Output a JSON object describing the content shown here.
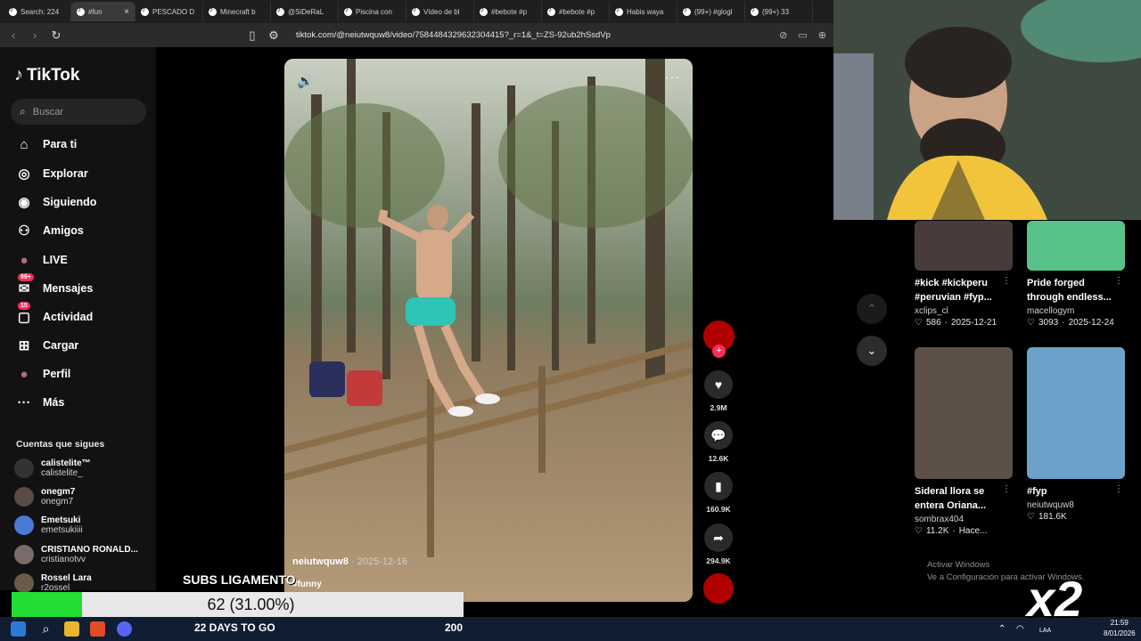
{
  "browser": {
    "tabs": [
      {
        "label": "Search: 224"
      },
      {
        "label": "#fun",
        "active": true
      },
      {
        "label": "PESCADO D"
      },
      {
        "label": "Minecraft b"
      },
      {
        "label": "@SiDeRaL"
      },
      {
        "label": "Piscina con"
      },
      {
        "label": "Vídeo de bl"
      },
      {
        "label": "#bebote #p"
      },
      {
        "label": "#bebote #p"
      },
      {
        "label": "Habis waya"
      },
      {
        "label": "(99+) #glogl"
      },
      {
        "label": "(99+) 33"
      }
    ],
    "url": "tiktok.com/@neiutwquw8/video/7584484329632304415?_r=1&_t=ZS-92ub2hSsdVp"
  },
  "tiktok": {
    "logo_text": "TikTok",
    "search_placeholder": "Buscar",
    "nav": [
      {
        "label": "Para ti",
        "icon": "home-icon"
      },
      {
        "label": "Explorar",
        "icon": "compass-icon"
      },
      {
        "label": "Siguiendo",
        "icon": "following-icon"
      },
      {
        "label": "Amigos",
        "icon": "friends-icon"
      },
      {
        "label": "LIVE",
        "icon": "live-icon"
      },
      {
        "label": "Mensajes",
        "icon": "messages-icon",
        "badge": "99+"
      },
      {
        "label": "Actividad",
        "icon": "activity-icon",
        "badge": "15"
      },
      {
        "label": "Cargar",
        "icon": "upload-icon"
      },
      {
        "label": "Perfil",
        "icon": "profile-icon"
      },
      {
        "label": "Más",
        "icon": "more-icon"
      }
    ],
    "following_title": "Cuentas que sigues",
    "following": [
      {
        "name": "calistelite™",
        "handle": "calistelite_"
      },
      {
        "name": "onegm7",
        "handle": "onegm7"
      },
      {
        "name": "Emetsuki",
        "handle": "emetsukiiii"
      },
      {
        "name": "CRISTIANO RONALD...",
        "handle": "cristianotvv"
      },
      {
        "name": "Rossel Lara",
        "handle": "r2ossel"
      }
    ]
  },
  "video": {
    "author": "neiutwquw8",
    "date": "2025-12-16",
    "hashtag": "#funny",
    "likes": "2.9M",
    "comments": "12.6K",
    "saves": "160.9K",
    "shares": "294.9K"
  },
  "related": [
    {
      "title1": "#kick #kickperu",
      "title2": "#peruvian #fyp...",
      "user": "xclips_cl",
      "likes": "586",
      "date": "2025-12-21"
    },
    {
      "title1": "Pride forged",
      "title2": "through endless...",
      "user": "macellogym",
      "likes": "3093",
      "date": "2025-12-24"
    },
    {
      "title1": "Sideral llora se",
      "title2": "entera Oriana...",
      "user": "sombrax404",
      "likes": "11.2K",
      "date": "Hace..."
    },
    {
      "title1": "#fyp",
      "title2": "",
      "user": "neiutwquw8",
      "likes": "181.6K",
      "date": ""
    }
  ],
  "stream_overlay": {
    "subs_label": "SUBS LIGAMENTO",
    "progress_text": "62 (31.00%)",
    "progress_fraction": 0.31,
    "days_text": "22 DAYS TO GO",
    "goal": "200",
    "multiplier": "x2"
  },
  "windows": {
    "watermark_line1": "Activar Windows",
    "watermark_line2": "Ve a Configuración para activar Windows.",
    "time": "21:59",
    "date": "8/01/2026",
    "lang": "LAA"
  }
}
